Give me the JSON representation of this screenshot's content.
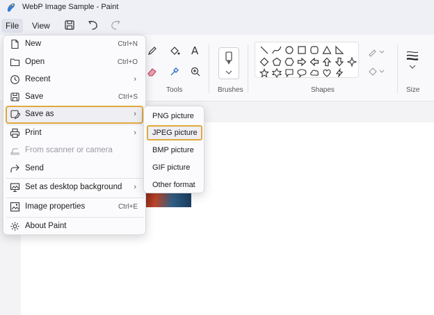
{
  "window": {
    "title": "WebP Image Sample - Paint"
  },
  "menubar": {
    "file_label": "File",
    "view_label": "View"
  },
  "quick_access": {
    "icons": [
      "save-icon",
      "undo-icon",
      "redo-icon"
    ]
  },
  "ribbon": {
    "groups": {
      "tools": "Tools",
      "brushes": "Brushes",
      "shapes": "Shapes",
      "size": "Size"
    }
  },
  "file_menu": {
    "items": [
      {
        "label": "New",
        "shortcut": "Ctrl+N",
        "icon": "new-file-icon"
      },
      {
        "label": "Open",
        "shortcut": "Ctrl+O",
        "icon": "folder-icon"
      },
      {
        "label": "Recent",
        "icon": "clock-icon",
        "has_submenu": true
      },
      {
        "label": "Save",
        "shortcut": "Ctrl+S",
        "icon": "save-icon"
      },
      {
        "label": "Save as",
        "icon": "save-as-icon",
        "has_submenu": true,
        "selected": true
      },
      {
        "label": "Print",
        "icon": "printer-icon",
        "has_submenu": true
      },
      {
        "label": "From scanner or camera",
        "icon": "scanner-icon",
        "disabled": true
      },
      {
        "label": "Send",
        "icon": "send-icon"
      },
      {
        "label": "Set as desktop background",
        "icon": "desktop-icon",
        "has_submenu": true
      },
      {
        "label": "Image properties",
        "shortcut": "Ctrl+E",
        "icon": "image-properties-icon"
      },
      {
        "label": "About Paint",
        "icon": "gear-icon"
      }
    ]
  },
  "save_as_menu": {
    "items": [
      {
        "label": "PNG picture"
      },
      {
        "label": "JPEG picture",
        "selected": true
      },
      {
        "label": "BMP picture"
      },
      {
        "label": "GIF picture"
      },
      {
        "label": "Other format"
      }
    ]
  },
  "colors": {
    "selection_border": "#e0a83c",
    "menu_bg": "#fbfbfd",
    "canvas": "#ffffff"
  }
}
